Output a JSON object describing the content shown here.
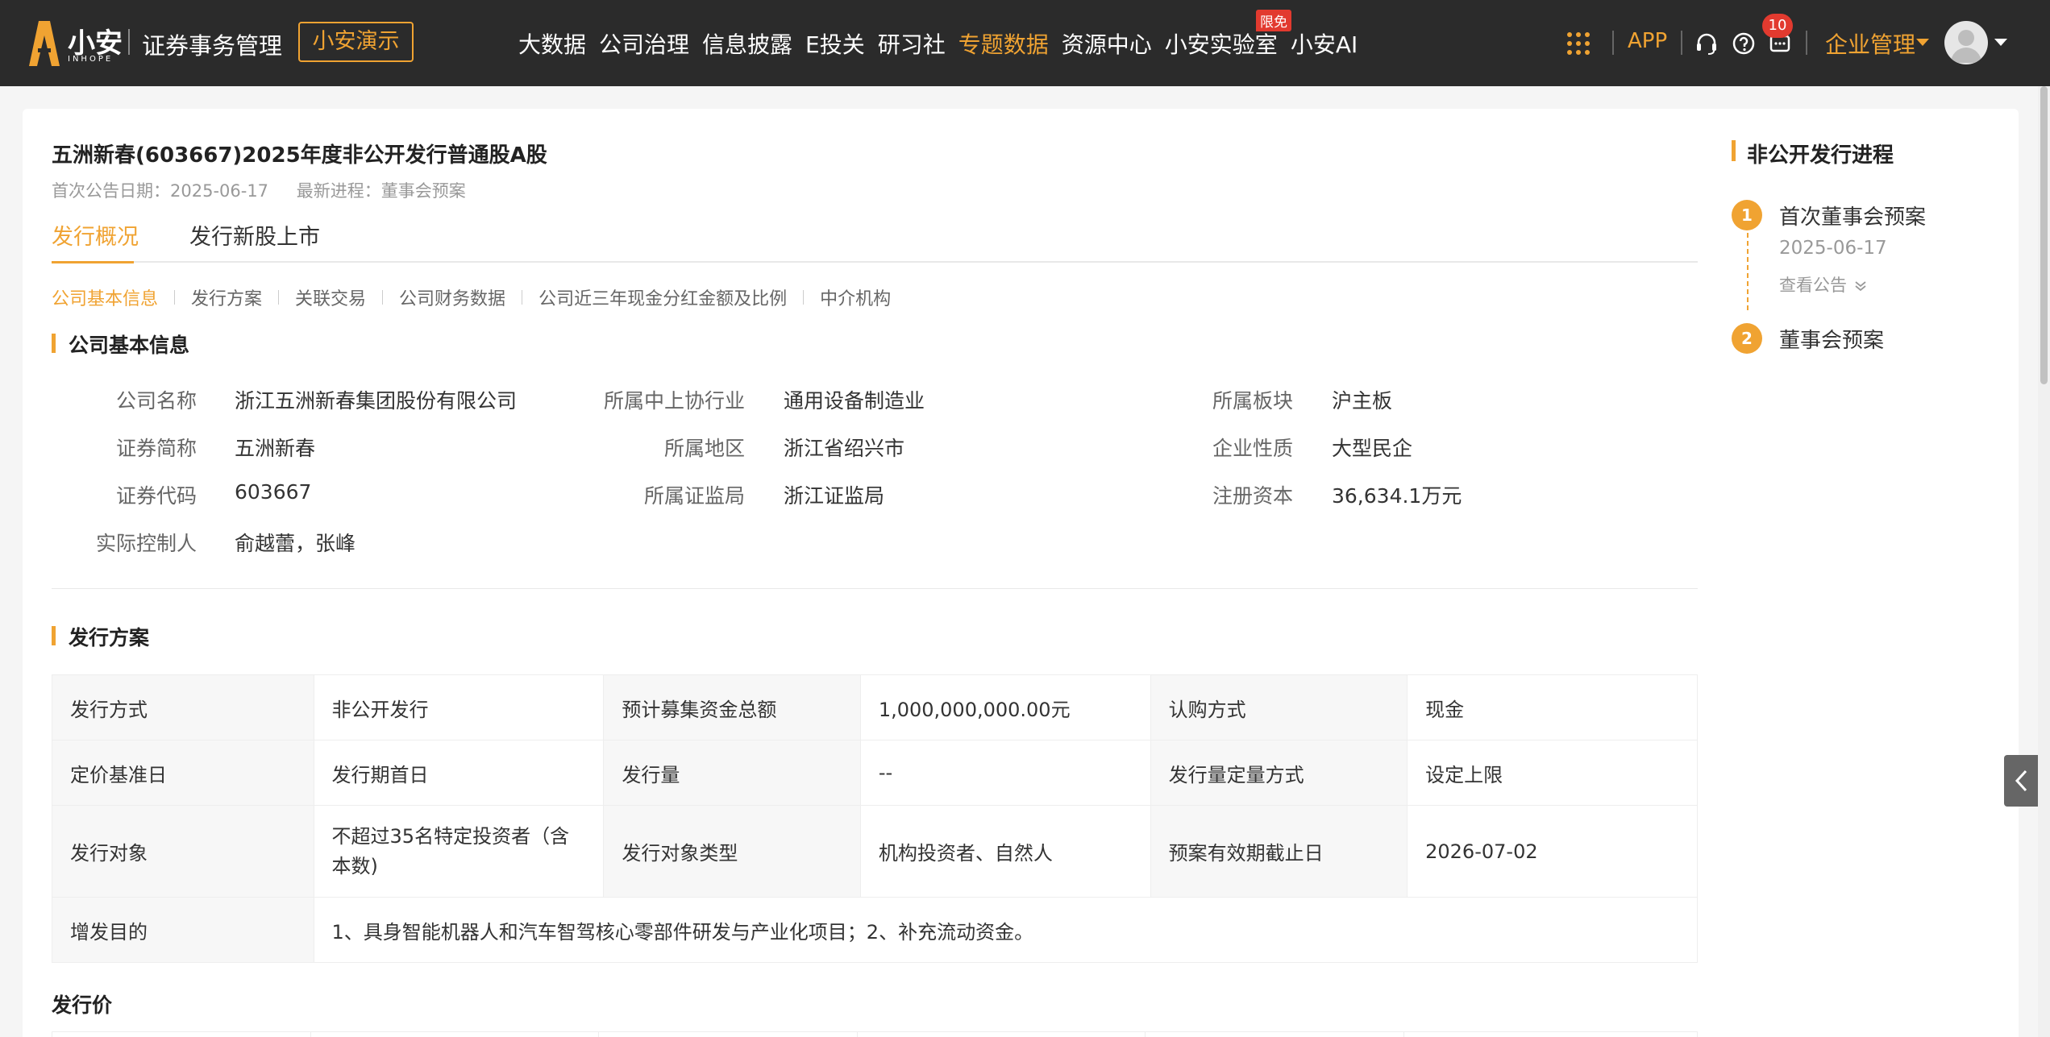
{
  "header": {
    "brand": "小安",
    "brand_sub": "INHOPE",
    "app_title": "证券事务管理",
    "demo_button": "小安演示",
    "nav": [
      {
        "label": "大数据",
        "active": false
      },
      {
        "label": "公司治理",
        "active": false
      },
      {
        "label": "信息披露",
        "active": false
      },
      {
        "label": "E投关",
        "active": false
      },
      {
        "label": "研习社",
        "active": false
      },
      {
        "label": "专题数据",
        "active": true
      },
      {
        "label": "资源中心",
        "active": false
      },
      {
        "label": "小安实验室",
        "active": false
      },
      {
        "label": "小安AI",
        "active": false
      }
    ],
    "free_badge": "限免",
    "app_link": "APP",
    "message_count": "10",
    "org_menu": "企业管理",
    "accent": "#f0a332"
  },
  "page": {
    "title": "五洲新春(603667)2025年度非公开发行普通股A股",
    "first_announce": "首次公告日期：2025-06-17",
    "latest_progress": "最新进程：董事会预案",
    "tabs": [
      "发行概况",
      "发行新股上市"
    ],
    "subnav": [
      "公司基本信息",
      "发行方案",
      "关联交易",
      "公司财务数据",
      "公司近三年现金分红金额及比例",
      "中介机构"
    ]
  },
  "basic_info": {
    "heading": "公司基本信息",
    "company_name": {
      "label": "公司名称",
      "value": "浙江五洲新春集团股份有限公司"
    },
    "industry": {
      "label": "所属中上协行业",
      "value": "通用设备制造业"
    },
    "board": {
      "label": "所属板块",
      "value": "沪主板"
    },
    "short_name": {
      "label": "证券简称",
      "value": "五洲新春"
    },
    "region": {
      "label": "所属地区",
      "value": "浙江省绍兴市"
    },
    "nature": {
      "label": "企业性质",
      "value": "大型民企"
    },
    "code": {
      "label": "证券代码",
      "value": "603667"
    },
    "regulator": {
      "label": "所属证监局",
      "value": "浙江证监局"
    },
    "capital": {
      "label": "注册资本",
      "value": "36,634.1万元"
    },
    "controller": {
      "label": "实际控制人",
      "value": "俞越蕾，张峰"
    }
  },
  "plan": {
    "heading": "发行方案",
    "rows": [
      [
        "发行方式",
        "非公开发行",
        "预计募集资金总额",
        "1,000,000,000.00元",
        "认购方式",
        "现金"
      ],
      [
        "定价基准日",
        "发行期首日",
        "发行量",
        "--",
        "发行量定量方式",
        "设定上限"
      ],
      [
        "发行对象",
        "不超过35名特定投资者（含本数)",
        "发行对象类型",
        "机构投资者、自然人",
        "预案有效期截止日",
        "2026-07-02"
      ]
    ],
    "purpose_label": "增发目的",
    "purpose_value": "1、具身智能机器人和汽车智驾核心零部件研发与产业化项目；2、补充流动资金。"
  },
  "price": {
    "heading": "发行价"
  },
  "progress": {
    "heading": "非公开发行进程",
    "steps": [
      {
        "num": "1",
        "title": "首次董事会预案",
        "date": "2025-06-17",
        "link": "查看公告"
      },
      {
        "num": "2",
        "title": "董事会预案"
      }
    ]
  }
}
